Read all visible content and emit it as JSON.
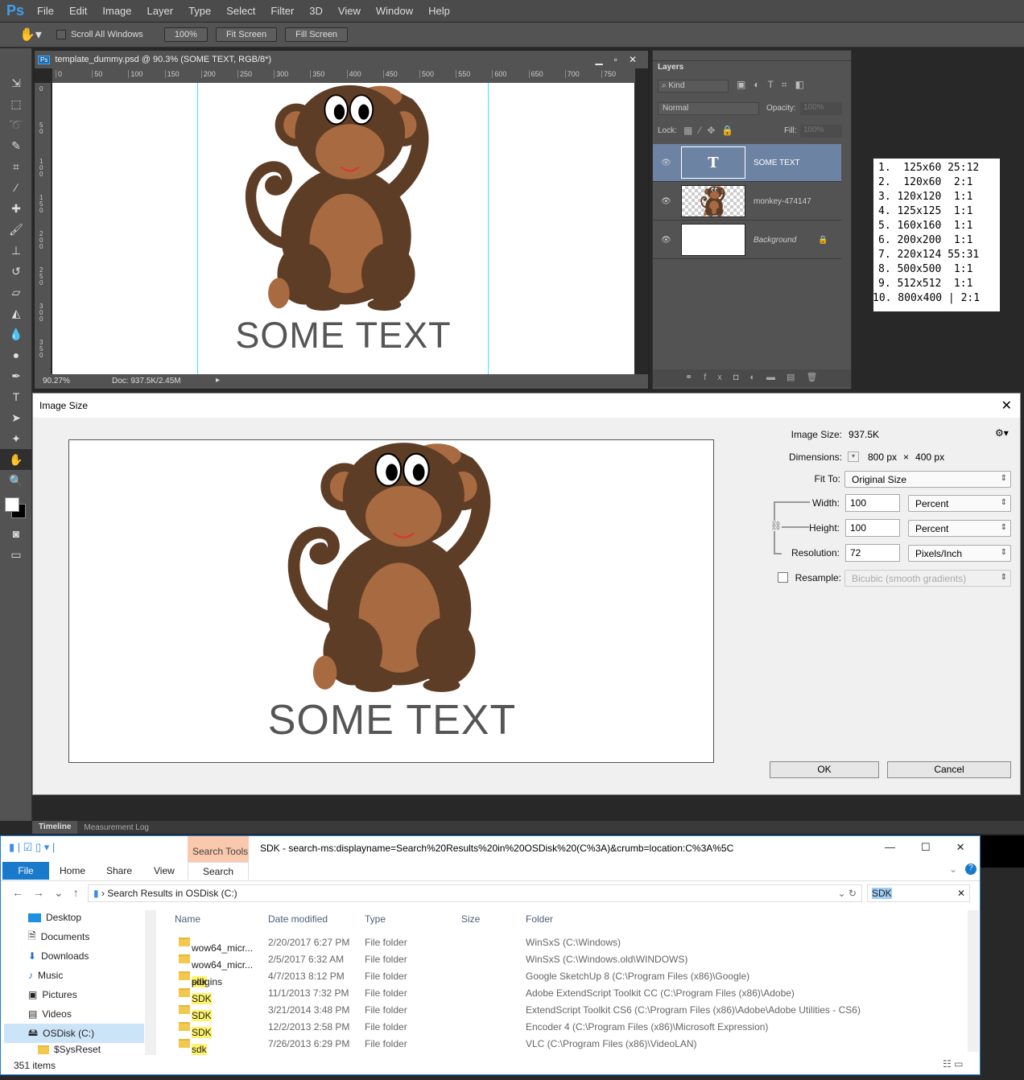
{
  "menubar": {
    "logo": "Ps",
    "items": [
      "File",
      "Edit",
      "Image",
      "Layer",
      "Type",
      "Select",
      "Filter",
      "3D",
      "View",
      "Window",
      "Help"
    ]
  },
  "options": {
    "scroll_all": "Scroll All Windows",
    "btn_100": "100%",
    "fit": "Fit Screen",
    "fill": "Fill Screen"
  },
  "document": {
    "title": "template_dummy.psd @ 90.3% (SOME TEXT, RGB/8*)",
    "ruler": [
      "0",
      "50",
      "100",
      "150",
      "200",
      "250",
      "300",
      "350",
      "400",
      "450",
      "500",
      "550",
      "600",
      "650",
      "700",
      "750"
    ],
    "vruler": [
      "0",
      "5 0",
      "1 0 0",
      "1 5 0",
      "2 0 0",
      "2 5 0",
      "3 0 0",
      "3 5 0"
    ],
    "zoom": "90.27%",
    "doc": "Doc: 937.5K/2.45M",
    "canvas_text": "SOME TEXT"
  },
  "layers": {
    "tab": "Layers",
    "kind": "Kind",
    "blend": "Normal",
    "opacity_label": "Opacity:",
    "opacity": "100%",
    "lock_label": "Lock:",
    "fill_label": "Fill:",
    "fill": "100%",
    "items": [
      {
        "name": "SOME TEXT",
        "selected": true
      },
      {
        "name": "monkey-474147"
      },
      {
        "name": "Background"
      }
    ]
  },
  "sizes_list": [
    "1.  125x60 25:12",
    "2.  120x60  2:1",
    "3. 120x120  1:1",
    "4. 125x125  1:1",
    "5. 160x160  1:1",
    "6. 200x200  1:1",
    "7. 220x124 55:31",
    "8. 500x500  1:1",
    "9. 512x512  1:1",
    "10. 800x400 | 2:1"
  ],
  "dialog": {
    "title": "Image Size",
    "image_size_label": "Image Size:",
    "image_size": "937.5K",
    "dimensions_label": "Dimensions:",
    "dim_w": "800 px",
    "dim_x": "×",
    "dim_h": "400 px",
    "fit_label": "Fit To:",
    "fit": "Original Size",
    "width_label": "Width:",
    "width": "100",
    "width_unit": "Percent",
    "height_label": "Height:",
    "height": "100",
    "height_unit": "Percent",
    "res_label": "Resolution:",
    "res": "72",
    "res_unit": "Pixels/Inch",
    "resample_label": "Resample:",
    "resample": "Bicubic (smooth gradients)",
    "resample_checked": false,
    "ok": "OK",
    "cancel": "Cancel",
    "preview_text": "SOME TEXT"
  },
  "timeline": {
    "tabs": [
      "Timeline",
      "Measurement Log"
    ]
  },
  "explorer": {
    "search_tools": "Search Tools",
    "title": "SDK - search-ms:displayname=Search%20Results%20in%20OSDisk%20(C%3A)&crumb=location:C%3A%5C",
    "tabs": [
      "File",
      "Home",
      "Share",
      "View",
      "Search"
    ],
    "address": "Search Results in OSDisk (C:)",
    "search": "SDK",
    "columns": [
      "Name",
      "Date modified",
      "Type",
      "Size",
      "Folder"
    ],
    "nav": [
      "Desktop",
      "Documents",
      "Downloads",
      "Music",
      "Pictures",
      "Videos",
      "OSDisk (C:)",
      "$SysReset"
    ],
    "rows": [
      {
        "pre": "wow64_micr...",
        "hl": "",
        "post": "",
        "date": "2/20/2017 6:27 PM",
        "type": "File folder",
        "folder": "WinSxS (C:\\Windows)"
      },
      {
        "pre": "wow64_micr...",
        "hl": "",
        "post": "",
        "date": "2/5/2017 6:32 AM",
        "type": "File folder",
        "folder": "WinSxS (C:\\Windows.old\\WINDOWS)"
      },
      {
        "pre": "",
        "hl": "sdk",
        "post": " plugins",
        "date": "4/7/2013 8:12 PM",
        "type": "File folder",
        "folder": "Google SketchUp 8 (C:\\Program Files (x86)\\Google)"
      },
      {
        "pre": "",
        "hl": "SDK",
        "post": "",
        "date": "11/1/2013 7:32 PM",
        "type": "File folder",
        "folder": "Adobe ExtendScript Toolkit CC (C:\\Program Files (x86)\\Adobe)"
      },
      {
        "pre": "",
        "hl": "SDK",
        "post": "",
        "date": "3/21/2014 3:48 PM",
        "type": "File folder",
        "folder": "ExtendScript Toolkit CS6 (C:\\Program Files (x86)\\Adobe\\Adobe Utilities - CS6)"
      },
      {
        "pre": "",
        "hl": "SDK",
        "post": "",
        "date": "12/2/2013 2:58 PM",
        "type": "File folder",
        "folder": "Encoder 4 (C:\\Program Files (x86)\\Microsoft Expression)"
      },
      {
        "pre": "",
        "hl": "sdk",
        "post": "",
        "date": "7/26/2013 6:29 PM",
        "type": "File folder",
        "folder": "VLC (C:\\Program Files (x86)\\VideoLAN)"
      }
    ],
    "status": "351 items",
    "window": {
      "min": "—",
      "max": "☐",
      "close": "✕"
    }
  }
}
